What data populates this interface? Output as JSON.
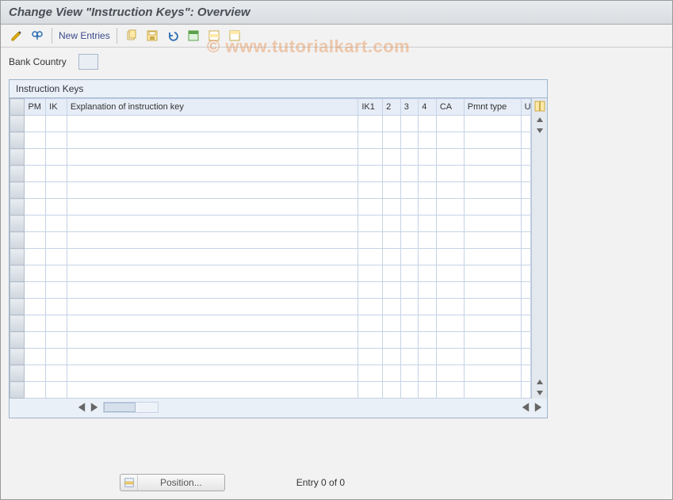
{
  "header": {
    "title": "Change View \"Instruction Keys\": Overview"
  },
  "toolbar": {
    "icons": {
      "display_change": "display-change-icon",
      "binoculars": "find-icon",
      "copy": "copy-icon",
      "save": "save-icon",
      "undo": "undo-icon",
      "select_all": "select-all-icon",
      "select_block": "select-block-icon",
      "deselect": "deselect-icon"
    },
    "new_entries": "New Entries"
  },
  "form": {
    "bank_country_label": "Bank Country",
    "bank_country_value": ""
  },
  "panel": {
    "title": "Instruction Keys",
    "columns": {
      "pm": "PM",
      "ik": "IK",
      "exp": "Explanation of instruction key",
      "ik1": "IK1",
      "c2": "2",
      "c3": "3",
      "c4": "4",
      "ca": "CA",
      "pmnt": "Pmnt type",
      "u": "U"
    },
    "rows": []
  },
  "footer": {
    "position_label": "Position...",
    "entry_text": "Entry 0 of 0"
  },
  "watermark": {
    "prefix": "© ",
    "text": "www.tutorialkart.com"
  }
}
